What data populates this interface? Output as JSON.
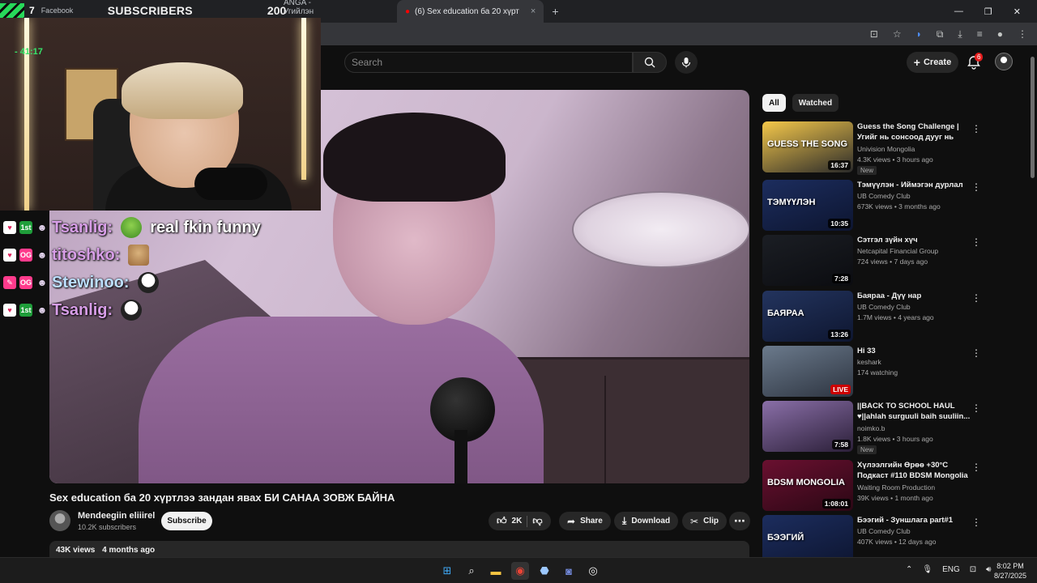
{
  "browser": {
    "tabs": [
      {
        "label": "Facebook",
        "active": false
      },
      {
        "label": "ANGA - Угийлэн саман",
        "active": false
      },
      {
        "label": "(6) Sex education ба 20 хүрт",
        "active": true
      }
    ],
    "new_tab_label": "+",
    "close_label": "×"
  },
  "overlay": {
    "facebook_count": "7",
    "subscribers_label": "SUBSCRIBERS",
    "subscribers_count": "200",
    "cam_counter": "- 41:17"
  },
  "chat": [
    {
      "badges": [
        "♥",
        "1st",
        "☻"
      ],
      "name": "Tsanlig:",
      "message": "real fkin funny",
      "emote": "frog"
    },
    {
      "badges": [
        "♥",
        "OG",
        "☻"
      ],
      "name": "titoshko:",
      "message": "",
      "emote": "cat"
    },
    {
      "badges": [
        "✎",
        "OG",
        "☻"
      ],
      "name": "Stewinoo:",
      "message": "",
      "emote": "dog"
    },
    {
      "badges": [
        "♥",
        "1st",
        "☻"
      ],
      "name": "Tsanlig:",
      "message": "",
      "emote": "dog"
    }
  ],
  "header": {
    "search_placeholder": "Search",
    "create_label": "Create",
    "notification_count": "6"
  },
  "video": {
    "title": "Sex education ба 20 хүртлээ зандан явах БИ САНАА ЗОВЖ БАЙНА",
    "channel_name": "Mendeegiin eliiirel",
    "channel_subs": "10.2K subscribers",
    "subscribe_label": "Subscribe",
    "likes": "2K",
    "share_label": "Share",
    "download_label": "Download",
    "clip_label": "Clip",
    "views": "43K views",
    "age": "4 months ago"
  },
  "sidebar": {
    "chips": [
      {
        "label": "All",
        "active": true
      },
      {
        "label": "Watched",
        "active": false
      }
    ],
    "recommendations": [
      {
        "title": "Guess the Song Challenge | Угийг нь сонсоод дууг нь таа...",
        "channel": "Univision Mongolia",
        "meta": "4.3K views • 3 hours ago",
        "badge": "New",
        "duration": "16:37",
        "live": false,
        "thumb_text": "GUESS THE SONG",
        "colors": [
          "#f5c84a",
          "#2a2a2a"
        ]
      },
      {
        "title": "Тэмүүлэн - Иймэгэн дурлал",
        "channel": "UB Comedy Club",
        "meta": "673K views • 3 months ago",
        "badge": "",
        "duration": "10:35",
        "live": false,
        "thumb_text": "ТЭМҮҮЛЭН",
        "colors": [
          "#1c2d5e",
          "#0d1530"
        ]
      },
      {
        "title": "Сэтгэл зүйн хүч",
        "channel": "Netcapital Financial Group",
        "meta": "724 views • 7 days ago",
        "badge": "",
        "duration": "7:28",
        "live": false,
        "thumb_text": "",
        "colors": [
          "#1b1e24",
          "#0b0c10"
        ]
      },
      {
        "title": "Баяраа - Дүү нар",
        "channel": "UB Comedy Club",
        "meta": "1.7M views • 4 years ago",
        "badge": "",
        "duration": "13:26",
        "live": false,
        "thumb_text": "БАЯРАА",
        "colors": [
          "#23345e",
          "#0e1630"
        ]
      },
      {
        "title": "Hi 33",
        "channel": "keshark",
        "meta": "174 watching",
        "badge": "",
        "duration": "LIVE",
        "live": true,
        "thumb_text": "",
        "colors": [
          "#6b7a8c",
          "#2d3440"
        ]
      },
      {
        "title": "||BACK TO SCHOOL HAUL ♥||ahlah surguuli baih suuliin...",
        "channel": "noimko.b",
        "meta": "1.8K views • 3 hours ago",
        "badge": "New",
        "duration": "7:58",
        "live": false,
        "thumb_text": "",
        "colors": [
          "#8a6fa8",
          "#2b1f38"
        ]
      },
      {
        "title": "Хүлээлгийн Өрөө +30°C Подкаст #110 BDSM Mongolia",
        "channel": "Waiting Room Production",
        "meta": "39K views • 1 month ago",
        "badge": "",
        "duration": "1:08:01",
        "live": false,
        "thumb_text": "BDSM MONGOLIA",
        "colors": [
          "#6a1030",
          "#2a0714"
        ]
      },
      {
        "title": "Бээгий - Зуншлага part#1",
        "channel": "UB Comedy Club",
        "meta": "407K views • 12 days ago",
        "badge": "",
        "duration": "",
        "live": false,
        "thumb_text": "БЭЭГИЙ",
        "colors": [
          "#1c2d5e",
          "#0d1530"
        ]
      }
    ]
  },
  "taskbar": {
    "language": "ENG",
    "time": "8:02 PM",
    "date": "8/27/2025"
  }
}
